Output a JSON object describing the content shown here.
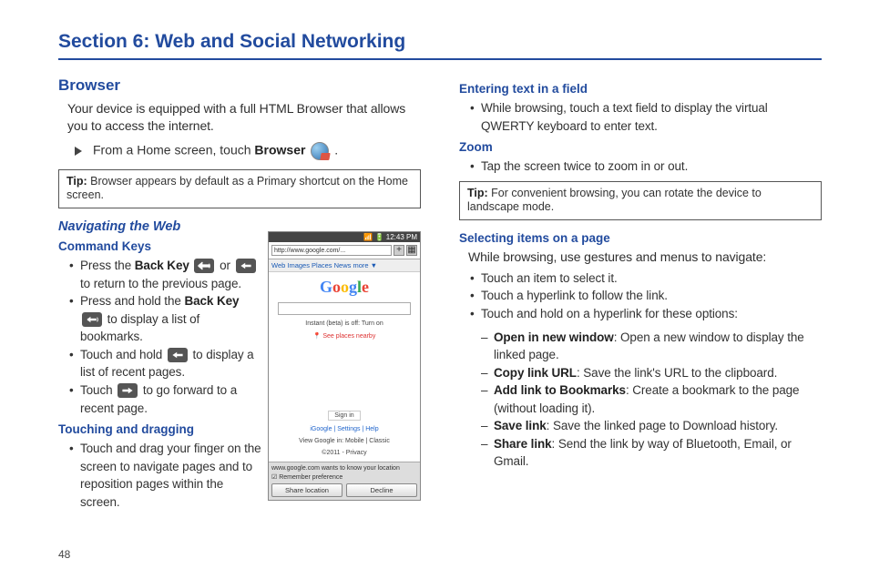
{
  "section_title": "Section 6: Web and Social Networking",
  "page_number": "48",
  "left": {
    "browser_heading": "Browser",
    "browser_intro": "Your device is equipped with a full HTML Browser that allows you to access the internet.",
    "step_prefix": "From a Home screen, touch ",
    "step_bold": "Browser",
    "step_suffix": " .",
    "tip_label": "Tip:",
    "tip_text": " Browser appears by default as a Primary shortcut on the Home screen.",
    "nav_heading": "Navigating the Web",
    "cmd_heading": "Command Keys",
    "cmd1_a": "Press the ",
    "cmd1_b": "Back Key",
    "cmd1_c": " or ",
    "cmd1_d": " to return to the previous page.",
    "cmd2_a": "Press and hold the ",
    "cmd2_b": "Back Key",
    "cmd2_c": " to display a list of bookmarks.",
    "cmd3_a": "Touch and hold ",
    "cmd3_b": " to display a list of recent pages.",
    "cmd4_a": "Touch ",
    "cmd4_b": " to go forward to a recent page.",
    "touch_heading": "Touching and dragging",
    "touch_item": "Touch and drag your finger on the screen to navigate pages and to reposition pages within the screen."
  },
  "right": {
    "enter_heading": "Entering text in a field",
    "enter_item": "While browsing, touch a text field to display the virtual QWERTY keyboard to enter text.",
    "zoom_heading": "Zoom",
    "zoom_item": "Tap the screen twice to zoom in or out.",
    "tip_label": "Tip:",
    "tip_text": " For convenient browsing, you can rotate the device to landscape mode.",
    "sel_heading": "Selecting items on a page",
    "sel_intro": "While browsing, use gestures and menus to navigate:",
    "sel1": "Touch an item to select it.",
    "sel2": "Touch a hyperlink to follow the link.",
    "sel3": "Touch and hold on a hyperlink for these options:",
    "opt1_b": "Open in new window",
    "opt1_t": ": Open a new window to display the linked page.",
    "opt2_b": "Copy link URL",
    "opt2_t": ": Save the link's URL to the clipboard.",
    "opt3_b": "Add link to Bookmarks",
    "opt3_t": ": Create a bookmark to the page (without loading it).",
    "opt4_b": "Save link",
    "opt4_t": ": Save the linked page to Download history.",
    "opt5_b": "Share link",
    "opt5_t": ": Send the link by way of Bluetooth, Email, or Gmail."
  },
  "phone": {
    "time": "12:43 PM",
    "url": "http://www.google.com/...",
    "nav": "Web  Images  Places  News  more ▼",
    "instant": "Instant (beta) is off: Turn on",
    "places": "See places nearby",
    "signin": "Sign in",
    "links": "iGoogle  |  Settings  |  Help",
    "view": "View Google in: Mobile | Classic",
    "copyright": "©2011 - Privacy",
    "loc_bar": "www.google.com wants to know your location",
    "remember": "Remember preference",
    "btn_share": "Share location",
    "btn_decline": "Decline"
  }
}
